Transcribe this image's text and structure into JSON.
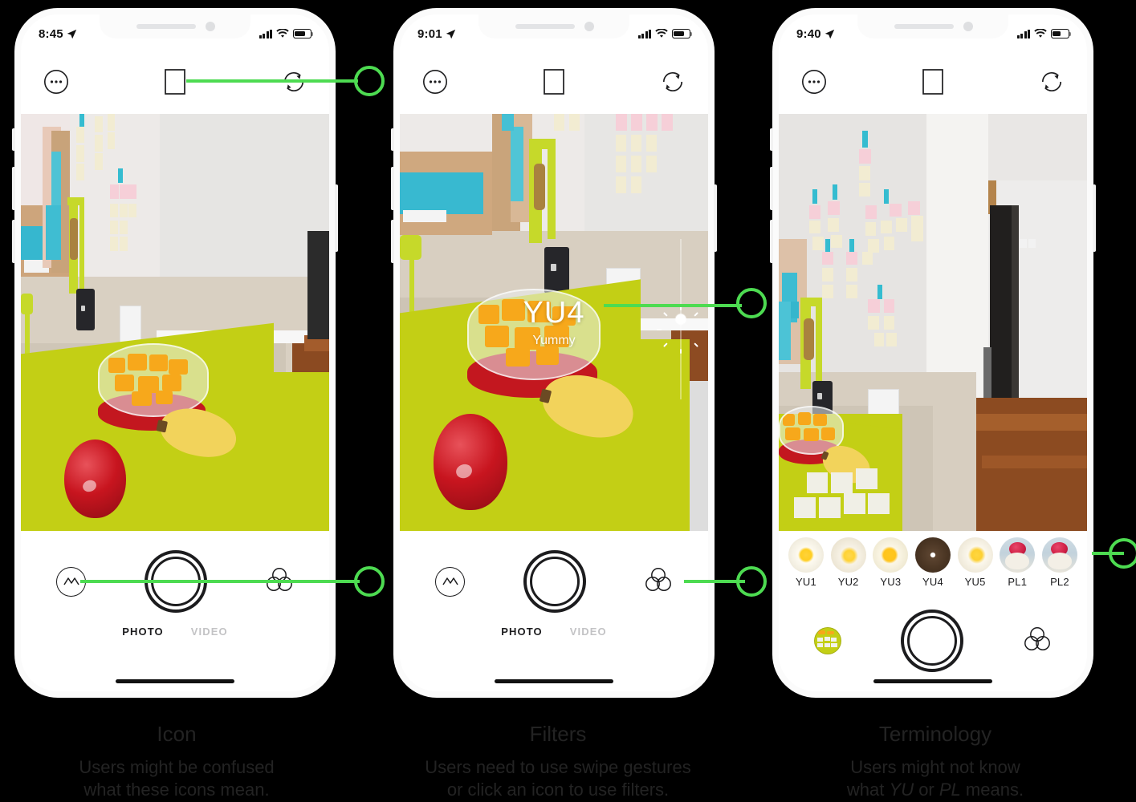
{
  "phones": [
    {
      "id": "phone-1",
      "status": {
        "time": "8:45",
        "location_icon": "location-arrow-icon",
        "signal": "signal-bars-icon",
        "wifi": "wifi-icon",
        "battery": "battery-icon"
      },
      "toolbar": {
        "more": "more-options-icon",
        "aspect": "aspect-ratio-icon",
        "flip": "flip-camera-icon"
      },
      "controls": {
        "left_icon": "mountain-filter-icon",
        "shutter": "shutter-button",
        "right_icon": "filters-three-circles-icon"
      },
      "modes": {
        "photo": "PHOTO",
        "video": "VIDEO",
        "active": "PHOTO"
      },
      "overlay": null,
      "filmstrip": null
    },
    {
      "id": "phone-2",
      "status": {
        "time": "9:01",
        "location_icon": "location-arrow-icon",
        "signal": "signal-bars-icon",
        "wifi": "wifi-icon",
        "battery": "battery-icon"
      },
      "toolbar": {
        "more": "more-options-icon",
        "aspect": "aspect-ratio-icon",
        "flip": "flip-camera-icon"
      },
      "controls": {
        "left_icon": "mountain-filter-icon",
        "shutter": "shutter-button",
        "right_icon": "filters-three-circles-icon"
      },
      "modes": {
        "photo": "PHOTO",
        "video": "VIDEO",
        "active": "PHOTO"
      },
      "overlay": {
        "filter_name": "YU4",
        "filter_subtitle": "Yummy",
        "exposure_icon": "brightness-sun-icon"
      },
      "filmstrip": null
    },
    {
      "id": "phone-3",
      "status": {
        "time": "9:40",
        "location_icon": "location-arrow-icon",
        "signal": "signal-bars-icon",
        "wifi": "wifi-icon",
        "battery": "battery-icon"
      },
      "toolbar": {
        "more": "more-options-icon",
        "aspect": "aspect-ratio-icon",
        "flip": "flip-camera-icon"
      },
      "controls": {
        "left_icon": "photo-thumbnail-preview",
        "shutter": "shutter-button",
        "right_icon": "filters-three-circles-icon"
      },
      "modes": null,
      "overlay": null,
      "filmstrip": {
        "selected": "YU4",
        "items": [
          {
            "label": "YU1",
            "style": "egg"
          },
          {
            "label": "YU2",
            "style": "egg2"
          },
          {
            "label": "YU3",
            "style": "egg3"
          },
          {
            "label": "YU4",
            "style": "dark"
          },
          {
            "label": "YU5",
            "style": "egg5"
          },
          {
            "label": "PL1",
            "style": "pl"
          },
          {
            "label": "PL2",
            "style": "pl"
          }
        ]
      }
    }
  ],
  "annotations": {
    "accent_color": "#4ddb51",
    "markers": [
      {
        "name": "flip-camera-callout",
        "target": "phone-1 top-right flip icon"
      },
      {
        "name": "filters-icon-callout",
        "target": "phone-1 bottom-right filters icon"
      },
      {
        "name": "filter-overlay-callout",
        "target": "phone-2 filter name overlay"
      },
      {
        "name": "filters-icon-callout-2",
        "target": "phone-2 bottom-right filters icon"
      },
      {
        "name": "filmstrip-callout",
        "target": "phone-3 filter strip"
      }
    ]
  },
  "captions": [
    {
      "title": "Icon",
      "line1": "Users might be confused",
      "line2": "what these icons mean."
    },
    {
      "title": "Filters",
      "line1": "Users need to use swipe gestures",
      "line2": "or click an icon to use filters."
    },
    {
      "title": "Terminology",
      "line1": "Users might not know",
      "line2_pre": "what ",
      "line2_em1": "YU",
      "line2_mid": " or ",
      "line2_em2": "PL",
      "line2_post": " means."
    }
  ]
}
